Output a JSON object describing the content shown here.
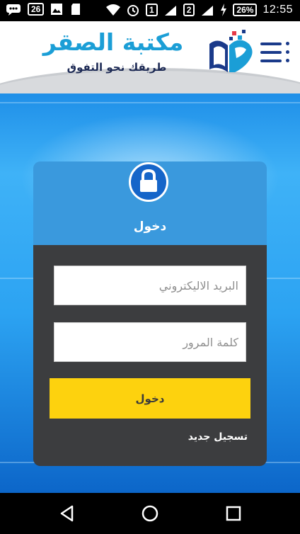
{
  "status_bar": {
    "left_icons": [
      "chat-icon",
      "sim-26-icon",
      "image-icon",
      "sd-card-icon"
    ],
    "sim1_badge": "26",
    "sim_slot_1": "1",
    "sim_slot_2": "2",
    "battery": "26%",
    "time": "12:55"
  },
  "header": {
    "title": "مكتبة الصقر",
    "subtitle": "طريقك نحو التفوق"
  },
  "login_card": {
    "title": "دخول",
    "email_placeholder": "البريد الاليكتروني",
    "password_placeholder": "كلمة المرور",
    "login_button": "دخول",
    "register_link": "تسجيل جديد"
  },
  "colors": {
    "brand_blue": "#1b9ed6",
    "card_header": "#3a99dd",
    "card_body": "#3c3d3f",
    "button_yellow": "#fdd20e"
  }
}
